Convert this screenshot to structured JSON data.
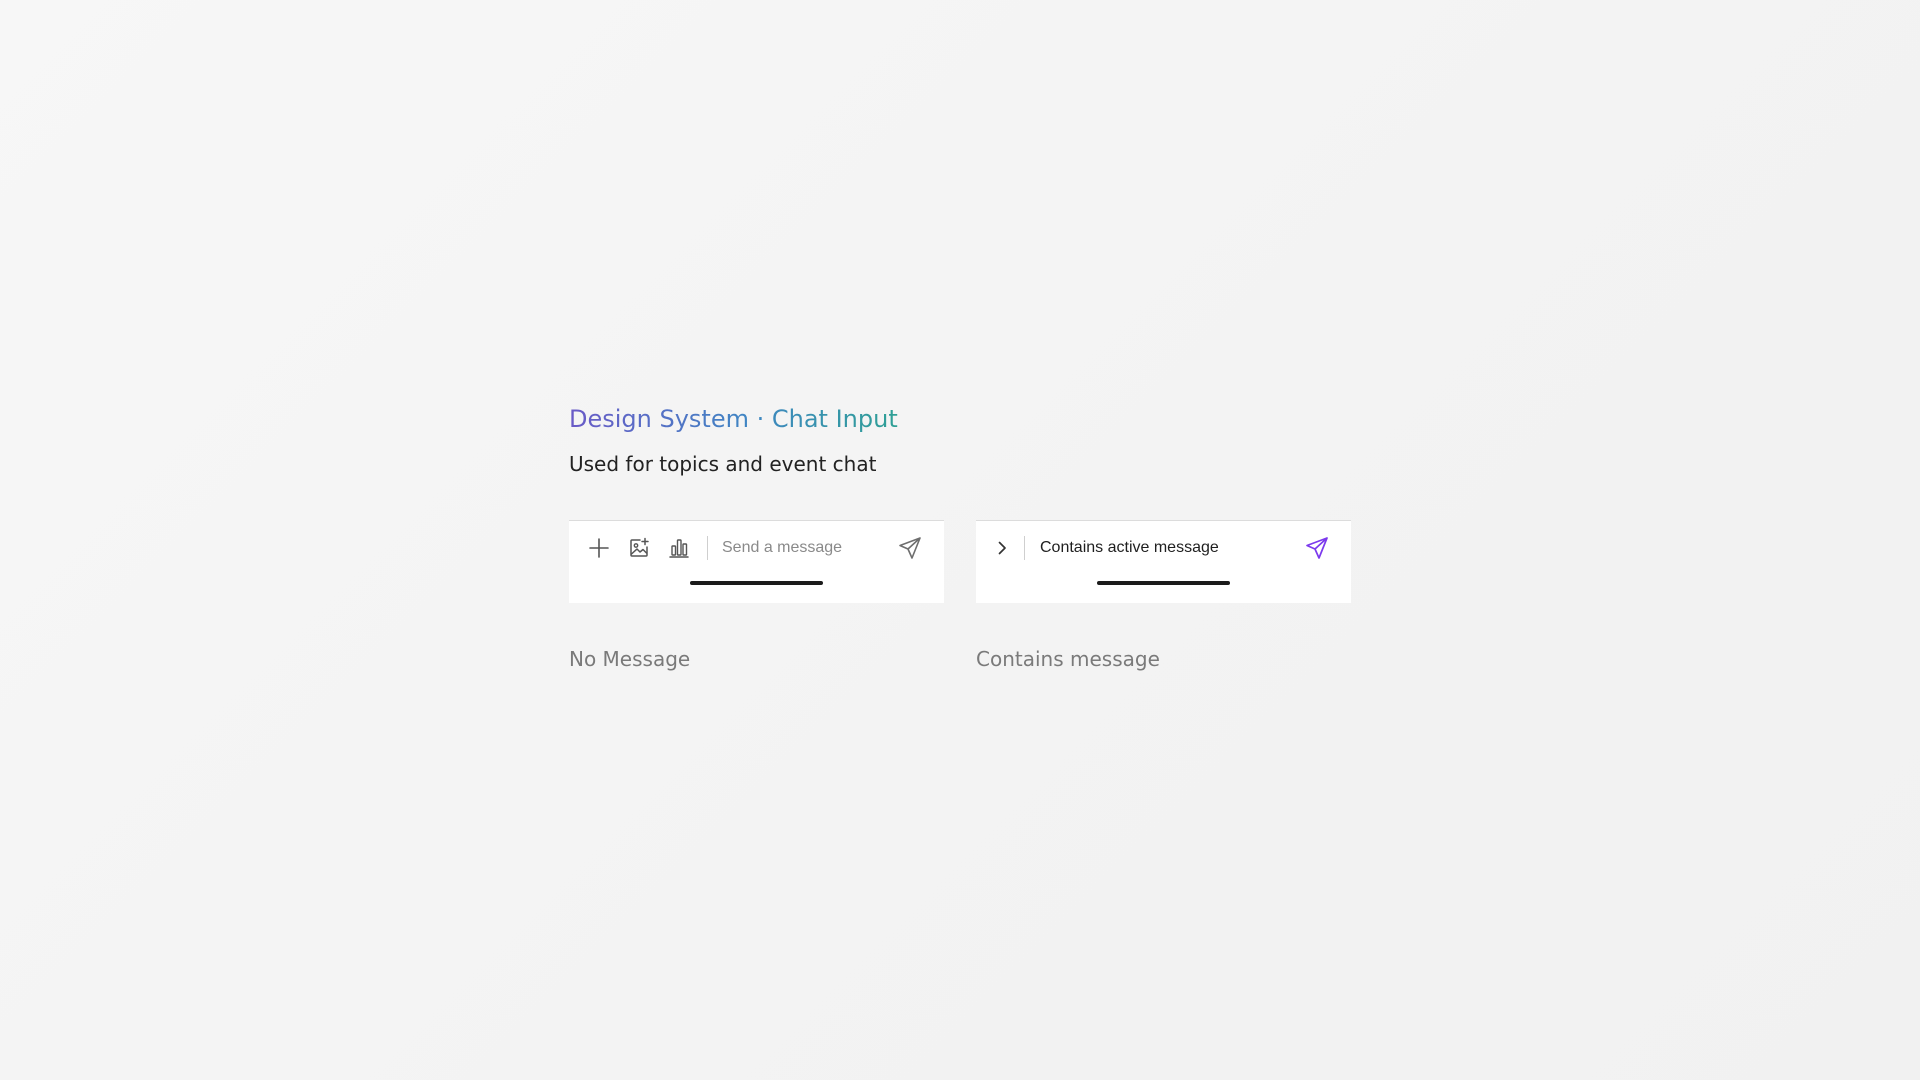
{
  "header": {
    "title": "Design System · Chat Input",
    "subtitle": "Used for topics and event chat"
  },
  "variants": [
    {
      "caption": "No Message",
      "placeholder": "Send a message",
      "icons": [
        "plus-icon",
        "image-add-icon",
        "bar-chart-icon",
        "send-icon"
      ],
      "send_color": "#6e6e6e"
    },
    {
      "caption": "Contains message",
      "message": "Contains active message",
      "icons": [
        "chevron-right-icon",
        "send-icon"
      ],
      "send_color": "#7c3aed"
    }
  ],
  "colors": {
    "title_gradient_start": "#6a5ac7",
    "title_gradient_end": "#2fa095",
    "accent": "#7c3aed"
  }
}
